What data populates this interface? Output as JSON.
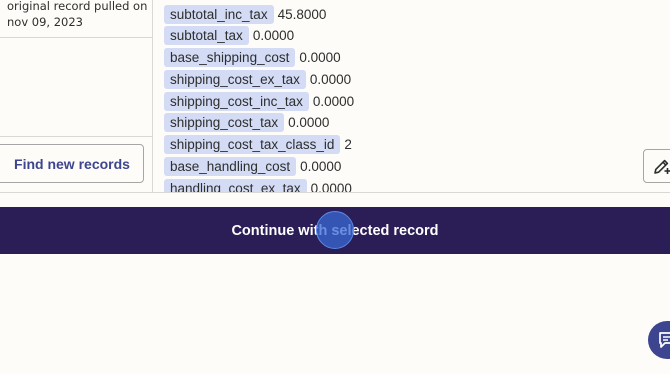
{
  "record_note": {
    "line1": "original record pulled on",
    "line2": "nov 09, 2023"
  },
  "find_button": {
    "label": "Find new records"
  },
  "fields": [
    {
      "key": "subtotal_inc_tax",
      "value": "45.8000"
    },
    {
      "key": "subtotal_tax",
      "value": "0.0000"
    },
    {
      "key": "base_shipping_cost",
      "value": "0.0000"
    },
    {
      "key": "shipping_cost_ex_tax",
      "value": "0.0000"
    },
    {
      "key": "shipping_cost_inc_tax",
      "value": "0.0000"
    },
    {
      "key": "shipping_cost_tax",
      "value": "0.0000"
    },
    {
      "key": "shipping_cost_tax_class_id",
      "value": "2"
    },
    {
      "key": "base_handling_cost",
      "value": "0.0000"
    },
    {
      "key": "handling_cost_ex_tax",
      "value": "0.0000"
    }
  ],
  "continue_button": {
    "label": "Continue with selected record"
  },
  "icons": {
    "edit": "pencil-plus-icon",
    "feedback": "chat-feedback-icon"
  },
  "colors": {
    "chip_bg": "#d3dbf5",
    "primary_dark": "#2b1d55",
    "accent": "#3d4591"
  }
}
